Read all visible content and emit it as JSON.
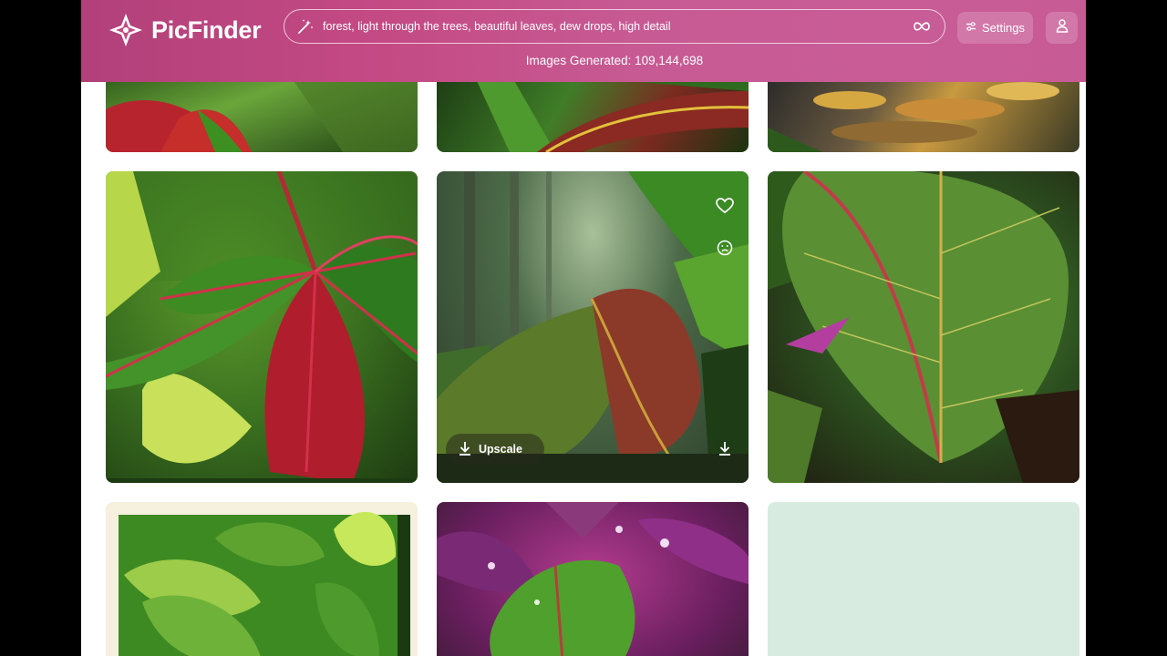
{
  "app": {
    "brand": "PicFinder"
  },
  "header": {
    "search_value": "forest, light through the trees, beautiful leaves, dew drops, high detail",
    "settings_label": "Settings",
    "images_generated_label": "Images Generated: 109,144,698"
  },
  "icons": {
    "logo": "picfinder-logo",
    "search": "magic-wand-icon",
    "loop": "infinity-icon",
    "settings": "sliders-icon",
    "user": "user-icon",
    "favorite": "heart-icon",
    "dislike": "sad-face-icon",
    "download": "download-icon"
  },
  "hovered_card": {
    "upscale_label": "Upscale"
  },
  "colors": {
    "header_accent": "#c44a84",
    "placeholder_tile": "#d7ebe1"
  }
}
